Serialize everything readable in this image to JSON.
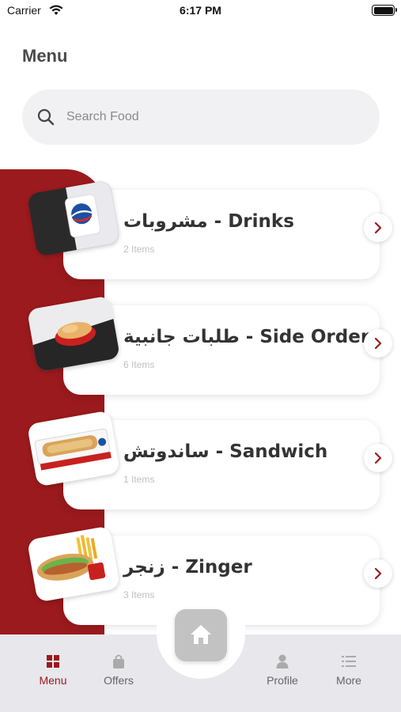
{
  "status_bar": {
    "carrier": "Carrier",
    "time": "6:17 PM"
  },
  "header": {
    "title": "Menu"
  },
  "search": {
    "placeholder": "Search Food"
  },
  "categories": [
    {
      "title": "مشروبات - Drinks",
      "count": "2 Items",
      "icon": "drinks-image"
    },
    {
      "title": "طلبات جانبية - Side Order",
      "count": "6 Items",
      "icon": "side-order-image"
    },
    {
      "title": "ساندوتش - Sandwich",
      "count": "1 Items",
      "icon": "sandwich-image"
    },
    {
      "title": "زنجر - Zinger",
      "count": "3 Items",
      "icon": "zinger-image"
    }
  ],
  "bottom_nav": {
    "items": [
      {
        "label": "Menu",
        "icon": "grid-icon",
        "active": true
      },
      {
        "label": "Offers",
        "icon": "bag-icon"
      },
      {
        "label": "Profile",
        "icon": "person-icon"
      },
      {
        "label": "More",
        "icon": "list-icon"
      }
    ],
    "home_icon": "home-icon"
  },
  "colors": {
    "accent": "#9a1a1d",
    "nav_bg": "#e7e7ec",
    "search_bg": "#f1f1f3"
  }
}
